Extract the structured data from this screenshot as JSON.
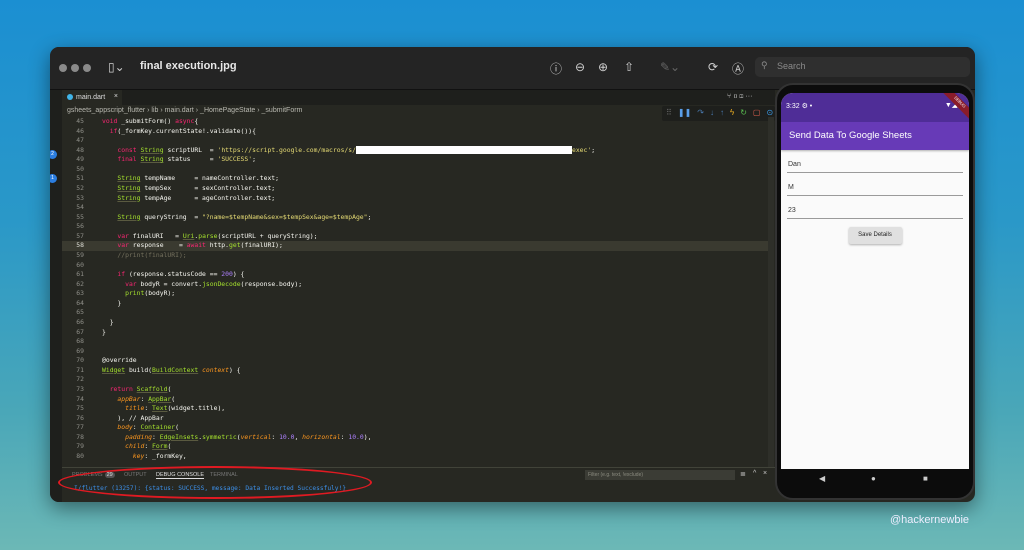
{
  "window": {
    "title": "final execution.jpg",
    "search_placeholder": "Search"
  },
  "editor": {
    "tab": "main.dart",
    "breadcrumb": "gsheets_appscript_flutter  ›  lib  ›  main.dart  ›  _HomePageState  ›  _submitForm",
    "badges": [
      "2",
      "1"
    ],
    "current_line": 58,
    "lines": [
      {
        "n": 45,
        "t": [
          [
            "k",
            "void"
          ],
          [
            "t",
            " _submitForm() "
          ],
          [
            "k",
            "async"
          ],
          [
            "t",
            "{"
          ]
        ]
      },
      {
        "n": 46,
        "t": [
          [
            "t",
            "  "
          ],
          [
            "k",
            "if"
          ],
          [
            "t",
            "(_formKey.currentState!.validate()){"
          ]
        ]
      },
      {
        "n": 47,
        "t": []
      },
      {
        "n": 48,
        "t": [
          [
            "t",
            "    "
          ],
          [
            "k",
            "const"
          ],
          [
            "t",
            " "
          ],
          [
            "ty",
            "String"
          ],
          [
            "t",
            " scriptURL  = "
          ],
          [
            "s",
            "'https://script.google.com/macros/s/"
          ],
          [
            "redact",
            ""
          ],
          [
            "s",
            "exec'"
          ],
          [
            "t",
            ";"
          ]
        ]
      },
      {
        "n": 49,
        "t": [
          [
            "t",
            "    "
          ],
          [
            "k",
            "final"
          ],
          [
            "t",
            " "
          ],
          [
            "ty",
            "String"
          ],
          [
            "t",
            " status     = "
          ],
          [
            "s",
            "'SUCCESS'"
          ],
          [
            "t",
            ";"
          ]
        ]
      },
      {
        "n": 50,
        "t": []
      },
      {
        "n": 51,
        "t": [
          [
            "t",
            "    "
          ],
          [
            "ty",
            "String"
          ],
          [
            "t",
            " tempName     = nameController.text;"
          ]
        ]
      },
      {
        "n": 52,
        "t": [
          [
            "t",
            "    "
          ],
          [
            "ty",
            "String"
          ],
          [
            "t",
            " tempSex      = sexController.text;"
          ]
        ]
      },
      {
        "n": 53,
        "t": [
          [
            "t",
            "    "
          ],
          [
            "ty",
            "String"
          ],
          [
            "t",
            " tempAge      = ageController.text;"
          ]
        ]
      },
      {
        "n": 54,
        "t": []
      },
      {
        "n": 55,
        "t": [
          [
            "t",
            "    "
          ],
          [
            "ty",
            "String"
          ],
          [
            "t",
            " queryString  = "
          ],
          [
            "s",
            "\"?name=$tempName&sex=$tempSex&age=$tempAge\""
          ],
          [
            "t",
            ";"
          ]
        ]
      },
      {
        "n": 56,
        "t": []
      },
      {
        "n": 57,
        "t": [
          [
            "t",
            "    "
          ],
          [
            "k",
            "var"
          ],
          [
            "t",
            " finalURI   = "
          ],
          [
            "ty",
            "Uri"
          ],
          [
            "t",
            "."
          ],
          [
            "f",
            "parse"
          ],
          [
            "t",
            "(scriptURL + queryString);"
          ]
        ]
      },
      {
        "n": 58,
        "t": [
          [
            "t",
            "    "
          ],
          [
            "k",
            "var"
          ],
          [
            "t",
            " response    = "
          ],
          [
            "k",
            "await"
          ],
          [
            "t",
            " http."
          ],
          [
            "f",
            "get"
          ],
          [
            "t",
            "(finalURI);"
          ]
        ]
      },
      {
        "n": 59,
        "t": [
          [
            "t",
            "    "
          ],
          [
            "c",
            "//print(finalURI);"
          ]
        ]
      },
      {
        "n": 60,
        "t": []
      },
      {
        "n": 61,
        "t": [
          [
            "t",
            "    "
          ],
          [
            "k",
            "if"
          ],
          [
            "t",
            " (response.statusCode == "
          ],
          [
            "n",
            "200"
          ],
          [
            "t",
            ") {"
          ]
        ]
      },
      {
        "n": 62,
        "t": [
          [
            "t",
            "      "
          ],
          [
            "k",
            "var"
          ],
          [
            "t",
            " bodyR = convert."
          ],
          [
            "f",
            "jsonDecode"
          ],
          [
            "t",
            "(response.body);"
          ]
        ]
      },
      {
        "n": 63,
        "t": [
          [
            "t",
            "      "
          ],
          [
            "f",
            "print"
          ],
          [
            "t",
            "(bodyR);"
          ]
        ]
      },
      {
        "n": 64,
        "t": [
          [
            "t",
            "    }"
          ]
        ]
      },
      {
        "n": 65,
        "t": []
      },
      {
        "n": 66,
        "t": [
          [
            "t",
            "  }"
          ]
        ]
      },
      {
        "n": 67,
        "t": [
          [
            "t",
            "}"
          ]
        ]
      },
      {
        "n": 68,
        "t": []
      },
      {
        "n": 69,
        "t": []
      },
      {
        "n": 70,
        "t": [
          [
            "t",
            "@override"
          ]
        ]
      },
      {
        "n": 71,
        "t": [
          [
            "ty",
            "Widget"
          ],
          [
            "t",
            " build("
          ],
          [
            "ty",
            "BuildContext"
          ],
          [
            "t",
            " "
          ],
          [
            "p",
            "context"
          ],
          [
            "t",
            ") {"
          ]
        ]
      },
      {
        "n": 72,
        "t": []
      },
      {
        "n": 73,
        "t": [
          [
            "t",
            "  "
          ],
          [
            "k",
            "return"
          ],
          [
            "t",
            " "
          ],
          [
            "ty",
            "Scaffold"
          ],
          [
            "t",
            "("
          ]
        ]
      },
      {
        "n": 74,
        "t": [
          [
            "t",
            "    "
          ],
          [
            "p",
            "appBar"
          ],
          [
            "t",
            ": "
          ],
          [
            "ty",
            "AppBar"
          ],
          [
            "t",
            "("
          ]
        ]
      },
      {
        "n": 75,
        "t": [
          [
            "t",
            "      "
          ],
          [
            "p",
            "title"
          ],
          [
            "t",
            ": "
          ],
          [
            "ty",
            "Text"
          ],
          [
            "t",
            "(widget.title),"
          ]
        ]
      },
      {
        "n": 76,
        "t": [
          [
            "t",
            "    ), // AppBar"
          ]
        ]
      },
      {
        "n": 77,
        "t": [
          [
            "t",
            "    "
          ],
          [
            "p",
            "body"
          ],
          [
            "t",
            ": "
          ],
          [
            "ty",
            "Container"
          ],
          [
            "t",
            "("
          ]
        ]
      },
      {
        "n": 78,
        "t": [
          [
            "t",
            "      "
          ],
          [
            "p",
            "padding"
          ],
          [
            "t",
            ": "
          ],
          [
            "ty",
            "EdgeInsets"
          ],
          [
            "t",
            "."
          ],
          [
            "f",
            "symmetric"
          ],
          [
            "t",
            "("
          ],
          [
            "p",
            "vertical"
          ],
          [
            "t",
            ": "
          ],
          [
            "n",
            "10.0"
          ],
          [
            "t",
            ", "
          ],
          [
            "p",
            "horizontal"
          ],
          [
            "t",
            ": "
          ],
          [
            "n",
            "10.0"
          ],
          [
            "t",
            "),"
          ]
        ]
      },
      {
        "n": 79,
        "t": [
          [
            "t",
            "      "
          ],
          [
            "p",
            "child"
          ],
          [
            "t",
            ": "
          ],
          [
            "ty",
            "Form"
          ],
          [
            "t",
            "("
          ]
        ]
      },
      {
        "n": 80,
        "t": [
          [
            "t",
            "        "
          ],
          [
            "p",
            "key"
          ],
          [
            "t",
            ": _formKey,"
          ]
        ]
      }
    ]
  },
  "panel": {
    "tabs": [
      "PROBLEMS",
      "OUTPUT",
      "DEBUG CONSOLE",
      "TERMINAL"
    ],
    "problems_count": "29",
    "active_tab": "DEBUG CONSOLE",
    "filter_placeholder": "Filter (e.g. text, !exclude)",
    "output": "I/flutter (13257): {status: SUCCESS, message: Data Inserted Successfuly!}"
  },
  "phone": {
    "time": "3:32",
    "debug_banner": "DEBUG",
    "app_title": "Send Data To Google Sheets",
    "fields": [
      "Dan",
      "M",
      "23"
    ],
    "button": "Save Details"
  },
  "annotation_color": "#e01a22",
  "watermark": "@hackernewbie"
}
